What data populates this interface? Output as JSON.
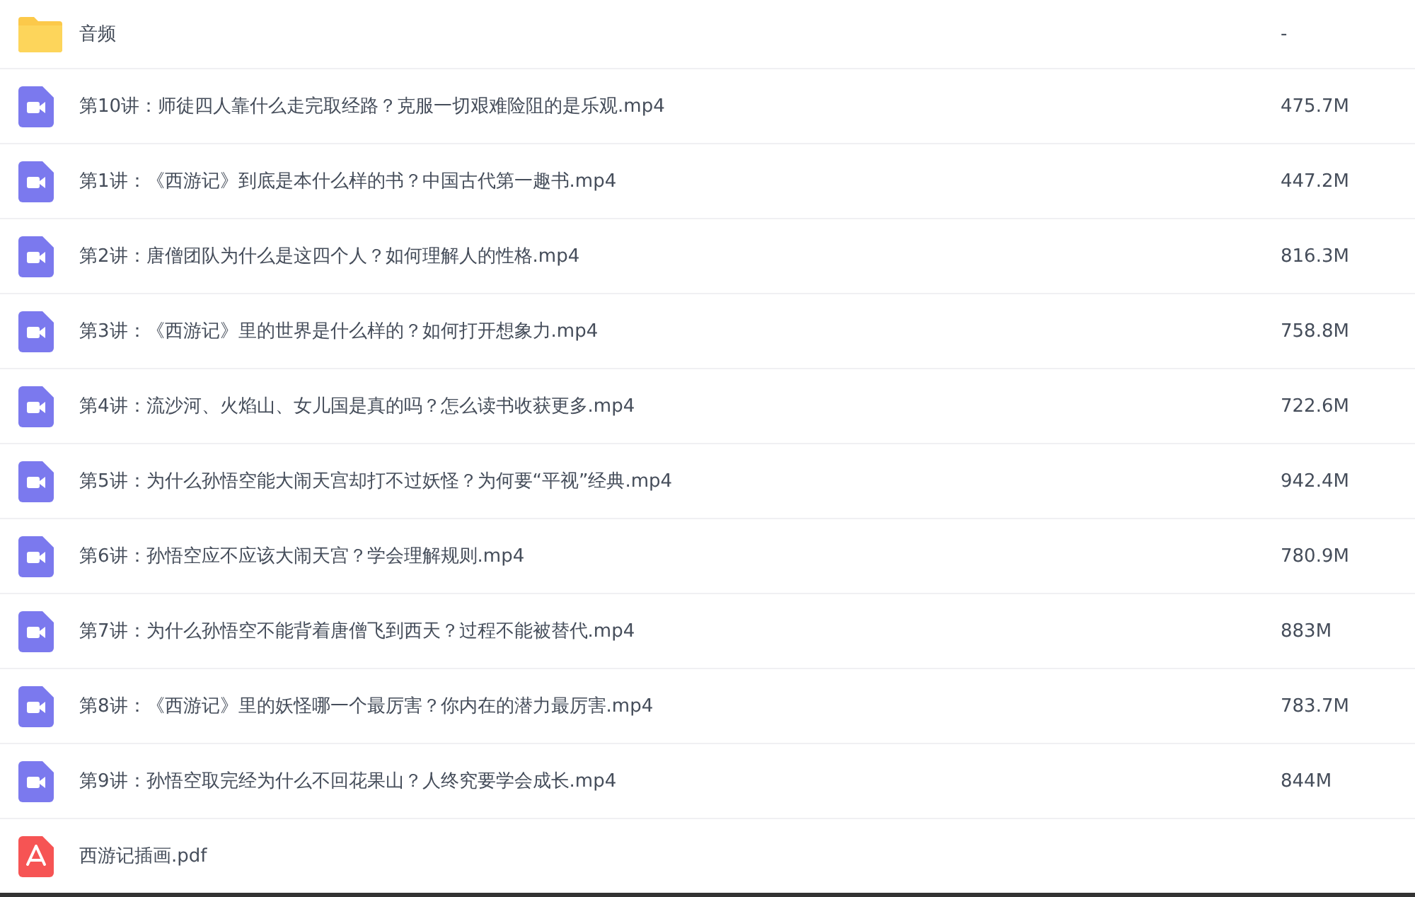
{
  "files": [
    {
      "kind": "folder",
      "name": "音频",
      "size": "-"
    },
    {
      "kind": "video",
      "name": "第10讲：师徒四人靠什么走完取经路？克服一切艰难险阻的是乐观.mp4",
      "size": "475.7M"
    },
    {
      "kind": "video",
      "name": "第1讲：《西游记》到底是本什么样的书？中国古代第一趣书.mp4",
      "size": "447.2M"
    },
    {
      "kind": "video",
      "name": "第2讲：唐僧团队为什么是这四个人？如何理解人的性格.mp4",
      "size": "816.3M"
    },
    {
      "kind": "video",
      "name": "第3讲：《西游记》里的世界是什么样的？如何打开想象力.mp4",
      "size": "758.8M"
    },
    {
      "kind": "video",
      "name": "第4讲：流沙河、火焰山、女儿国是真的吗？怎么读书收获更多.mp4",
      "size": "722.6M"
    },
    {
      "kind": "video",
      "name": "第5讲：为什么孙悟空能大闹天宫却打不过妖怪？为何要“平视”经典.mp4",
      "size": "942.4M"
    },
    {
      "kind": "video",
      "name": "第6讲：孙悟空应不应该大闹天宫？学会理解规则.mp4",
      "size": "780.9M"
    },
    {
      "kind": "video",
      "name": "第7讲：为什么孙悟空不能背着唐僧飞到西天？过程不能被替代.mp4",
      "size": "883M"
    },
    {
      "kind": "video",
      "name": "第8讲：《西游记》里的妖怪哪一个最厉害？你内在的潜力最厉害.mp4",
      "size": "783.7M"
    },
    {
      "kind": "video",
      "name": "第9讲：孙悟空取完经为什么不回花果山？人终究要学会成长.mp4",
      "size": "844M"
    },
    {
      "kind": "pdf",
      "name": "西游记插画.pdf"
    }
  ]
}
